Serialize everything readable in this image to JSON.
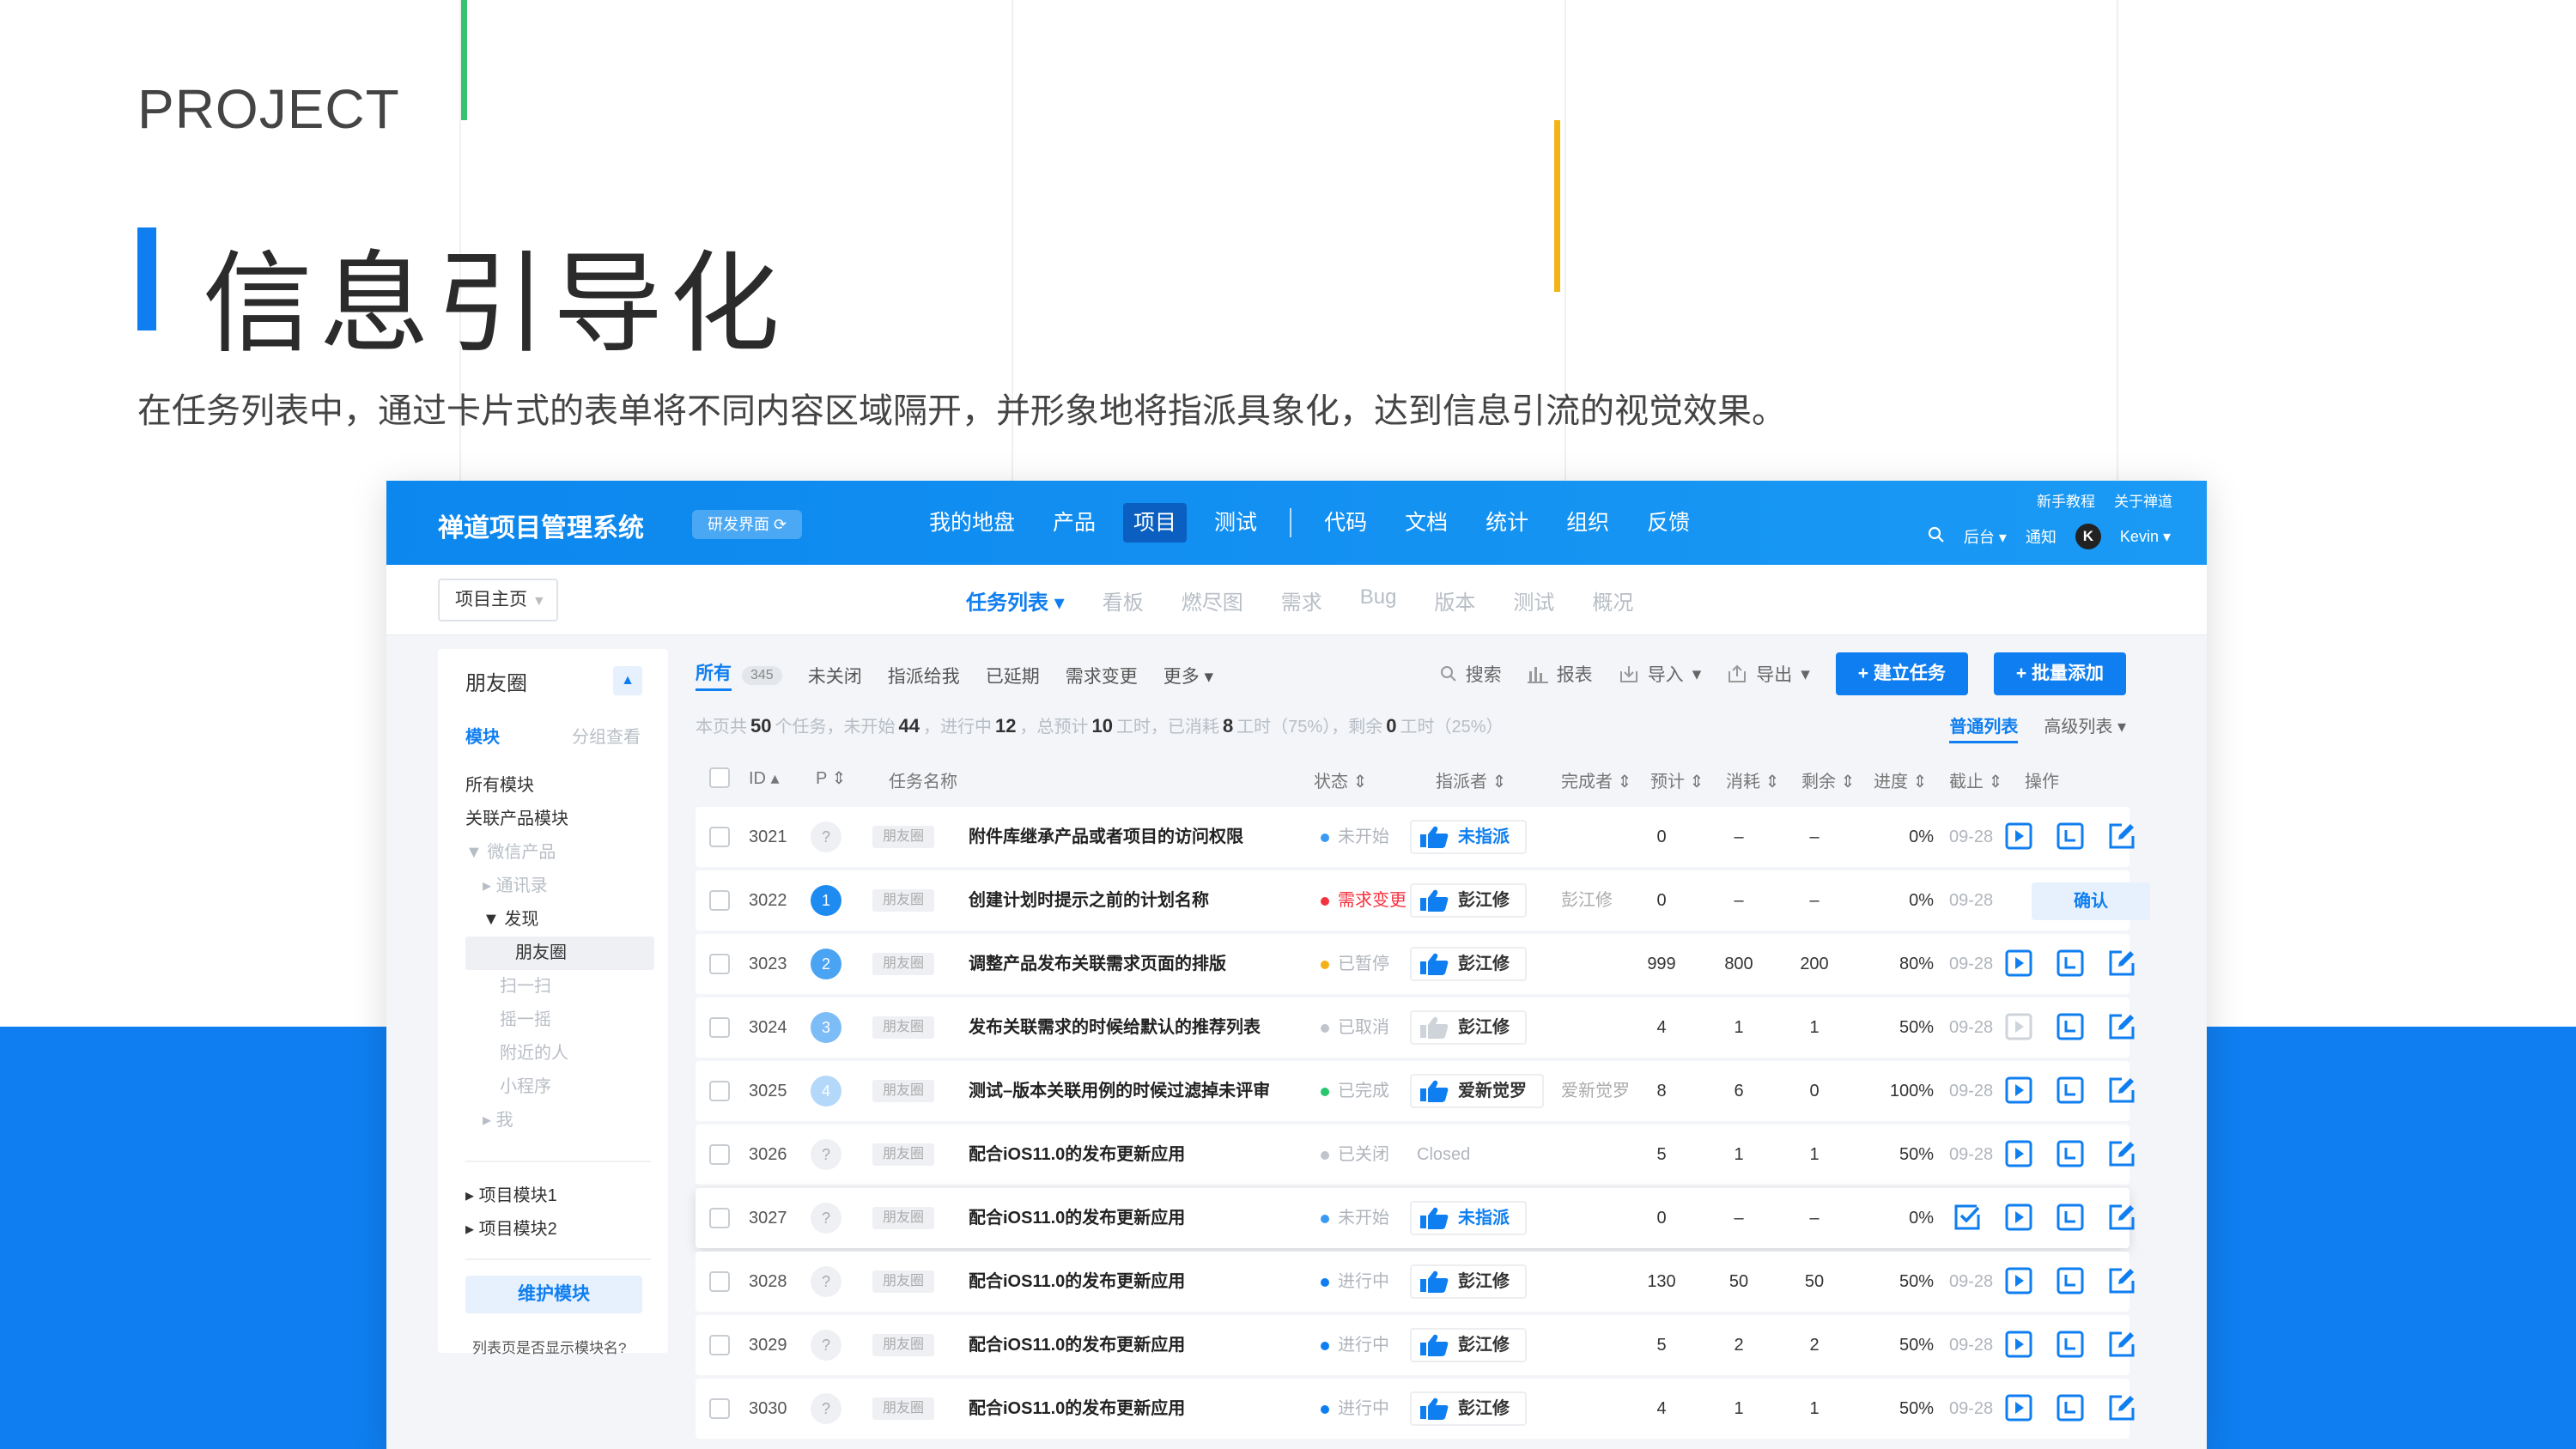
{
  "slide": {
    "label": "PROJECT",
    "title": "信息引导化",
    "description": "在任务列表中，通过卡片式的表单将不同内容区域隔开，并形象地将指派具象化，达到信息引流的视觉效果。"
  },
  "app": {
    "brand": "禅道项目管理系统",
    "env_badge": "研发界面",
    "nav": [
      "我的地盘",
      "产品",
      "项目",
      "测试",
      "代码",
      "文档",
      "统计",
      "组织",
      "反馈"
    ],
    "nav_active": "项目",
    "top_links": [
      "新手教程",
      "关于禅道"
    ],
    "top_right": {
      "admin": "后台",
      "notify": "通知",
      "avatar_letter": "K",
      "user": "Kevin"
    },
    "project_select": "项目主页",
    "subnav": [
      "任务列表",
      "看板",
      "燃尽图",
      "需求",
      "Bug",
      "版本",
      "测试",
      "概况"
    ],
    "subnav_active": "任务列表",
    "colors": {
      "primary": "#0f7ef0",
      "red": "#f5333f",
      "yellow": "#f5b014",
      "green": "#28c76f",
      "gray": "#c0c5cb"
    }
  },
  "sidebar": {
    "title": "朋友圈",
    "tab_modules": "模块",
    "tab_group": "分组查看",
    "items": [
      {
        "label": "所有模块",
        "indent": 0,
        "style": "normal"
      },
      {
        "label": "关联产品模块",
        "indent": 0,
        "style": "normal"
      },
      {
        "label": "▼ 微信产品",
        "indent": 0,
        "style": "muted"
      },
      {
        "label": "▸ 通讯录",
        "indent": 1,
        "style": "muted"
      },
      {
        "label": "▼ 发现",
        "indent": 1,
        "style": "normal"
      },
      {
        "label": "朋友圈",
        "indent": 2,
        "style": "sel"
      },
      {
        "label": "扫一扫",
        "indent": 2,
        "style": "muted"
      },
      {
        "label": "摇一摇",
        "indent": 2,
        "style": "muted"
      },
      {
        "label": "附近的人",
        "indent": 2,
        "style": "muted"
      },
      {
        "label": "小程序",
        "indent": 2,
        "style": "muted"
      },
      {
        "label": "▸ 我",
        "indent": 1,
        "style": "muted"
      }
    ],
    "modules2": [
      "▸  项目模块1",
      "▸  项目模块2"
    ],
    "maintain_button": "维护模块",
    "note": "列表页是否显示模块名?"
  },
  "filters": {
    "tabs": [
      "所有",
      "未关闭",
      "指派给我",
      "已延期",
      "需求变更",
      "更多 ▾"
    ],
    "active": "所有",
    "all_count": "345"
  },
  "toolbar": {
    "search": "搜索",
    "report": "报表",
    "import": "导入",
    "export": "导出",
    "create": "+ 建立任务",
    "batch": "+ 批量添加"
  },
  "summary": {
    "p1": "本页共",
    "total": "50",
    "p2": "个任务，未开始",
    "not_started": "44",
    "p3": "，进行中",
    "in_progress": "12",
    "p4": "，总预计",
    "estimate": "10",
    "p5": "工时，已消耗",
    "consumed": "8",
    "p6": "工时（75%），剩余",
    "left": "0",
    "p7": "工时（25%）"
  },
  "view_tabs": [
    "普通列表",
    "高级列表 ▾"
  ],
  "table": {
    "headers": [
      "ID ▴",
      "P ⇕",
      "任务名称",
      "状态 ⇕",
      "指派者 ⇕",
      "完成者 ⇕",
      "预计 ⇕",
      "消耗 ⇕",
      "剩余 ⇕",
      "进度 ⇕",
      "截止 ⇕",
      "操作"
    ],
    "rows": [
      {
        "id": "3021",
        "p": "?",
        "tag": "朋友圈",
        "name": "附件库继承产品或者项目的访问权限",
        "status": "未开始",
        "status_color": "#3a9af2",
        "assignee": "未指派",
        "assignee_blue": true,
        "finisher": "",
        "est": "0",
        "cons": "–",
        "left": "–",
        "progress": "0%",
        "deadline": "09-28",
        "actions": [
          "start",
          "record",
          "edit"
        ]
      },
      {
        "id": "3022",
        "p": "1",
        "tag": "朋友圈",
        "name": "创建计划时提示之前的计划名称",
        "status": "需求变更",
        "status_color": "#f5333f",
        "assignee": "彭江修",
        "assignee_blue": false,
        "finisher": "彭江修",
        "est": "0",
        "cons": "–",
        "left": "–",
        "progress": "0%",
        "deadline": "09-28",
        "actions": [
          "confirm"
        ],
        "confirm_label": "确认"
      },
      {
        "id": "3023",
        "p": "2",
        "tag": "朋友圈",
        "name": "调整产品发布关联需求页面的排版",
        "status": "已暂停",
        "status_color": "#f5b014",
        "assignee": "彭江修",
        "assignee_blue": false,
        "finisher": "",
        "est": "999",
        "cons": "800",
        "left": "200",
        "progress": "80%",
        "deadline": "09-28",
        "actions": [
          "start",
          "record",
          "edit"
        ]
      },
      {
        "id": "3024",
        "p": "3",
        "tag": "朋友圈",
        "name": "发布关联需求的时候给默认的推荐列表",
        "status": "已取消",
        "status_color": "#c0c5cb",
        "assignee": "彭江修",
        "assignee_blue": false,
        "finisher": "",
        "est": "4",
        "cons": "1",
        "left": "1",
        "progress": "50%",
        "deadline": "09-28",
        "actions": [
          "start-disabled",
          "record",
          "edit"
        ]
      },
      {
        "id": "3025",
        "p": "4",
        "tag": "朋友圈",
        "name": "测试–版本关联用例的时候过滤掉未评审",
        "status": "已完成",
        "status_color": "#28c76f",
        "assignee": "爱新觉罗",
        "assignee_blue": false,
        "finisher": "爱新觉罗",
        "est": "8",
        "cons": "6",
        "left": "0",
        "progress": "100%",
        "deadline": "09-28",
        "actions": [
          "start",
          "record",
          "edit"
        ]
      },
      {
        "id": "3026",
        "p": "?",
        "tag": "朋友圈",
        "name": "配合iOS11.0的发布更新应用",
        "status": "已关闭",
        "status_color": "#c0c5cb",
        "assignee": "Closed",
        "assignee_closed": true,
        "finisher": "",
        "est": "5",
        "cons": "1",
        "left": "1",
        "progress": "50%",
        "deadline": "09-28",
        "actions": [
          "start",
          "record",
          "edit"
        ]
      },
      {
        "id": "3027",
        "p": "?",
        "tag": "朋友圈",
        "name": "配合iOS11.0的发布更新应用",
        "status": "未开始",
        "status_color": "#3a9af2",
        "assignee": "未指派",
        "assignee_blue": true,
        "finisher": "",
        "est": "0",
        "cons": "–",
        "left": "–",
        "progress": "0%",
        "deadline": "",
        "actions": [
          "check",
          "start",
          "record",
          "edit"
        ],
        "highlight": true
      },
      {
        "id": "3028",
        "p": "?",
        "tag": "朋友圈",
        "name": "配合iOS11.0的发布更新应用",
        "status": "进行中",
        "status_color": "#0f7ef0",
        "assignee": "彭江修",
        "assignee_blue": false,
        "finisher": "",
        "est": "130",
        "cons": "50",
        "left": "50",
        "progress": "50%",
        "deadline": "09-28",
        "actions": [
          "start",
          "record",
          "edit"
        ]
      },
      {
        "id": "3029",
        "p": "?",
        "tag": "朋友圈",
        "name": "配合iOS11.0的发布更新应用",
        "status": "进行中",
        "status_color": "#0f7ef0",
        "assignee": "彭江修",
        "assignee_blue": false,
        "finisher": "",
        "est": "5",
        "cons": "2",
        "left": "2",
        "progress": "50%",
        "deadline": "09-28",
        "actions": [
          "start",
          "record",
          "edit"
        ]
      },
      {
        "id": "3030",
        "p": "?",
        "tag": "朋友圈",
        "name": "配合iOS11.0的发布更新应用",
        "status": "进行中",
        "status_color": "#0f7ef0",
        "assignee": "彭江修",
        "assignee_blue": false,
        "finisher": "",
        "est": "4",
        "cons": "1",
        "left": "1",
        "progress": "50%",
        "deadline": "09-28",
        "actions": [
          "start",
          "record",
          "edit"
        ]
      }
    ]
  }
}
